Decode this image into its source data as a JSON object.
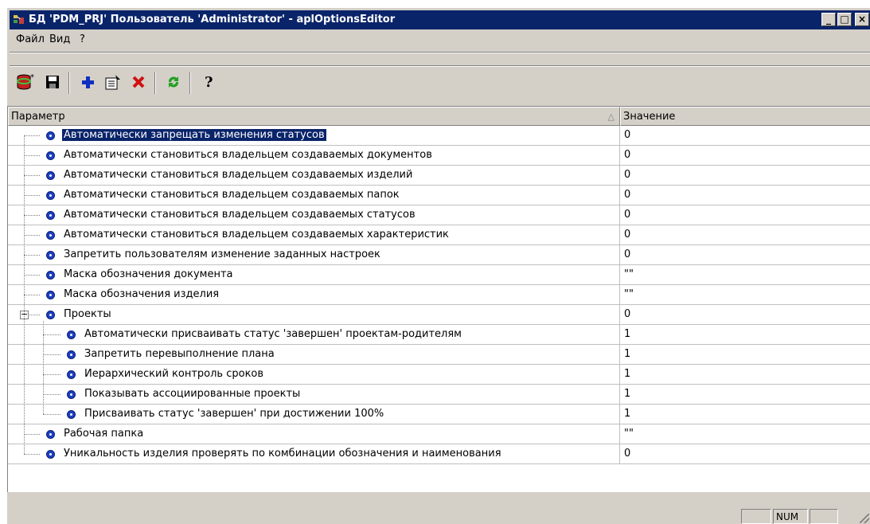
{
  "window": {
    "title": "БД 'PDM_PRJ' Пользователь 'Administrator' - aplOptionsEditor",
    "min_label": "_",
    "max_label": "□",
    "close_label": "×"
  },
  "menu": {
    "file": "Файл",
    "view": "Вид",
    "help": "?"
  },
  "toolbar": {
    "buttons": [
      "connect-db",
      "save",
      "add",
      "properties",
      "delete",
      "refresh",
      "help"
    ]
  },
  "grid": {
    "columns": {
      "param": "Параметр",
      "value": "Значение"
    },
    "rows": [
      {
        "label": "Автоматически запрещать изменения статусов",
        "value": "0",
        "level": 0,
        "selected": true
      },
      {
        "label": "Автоматически становиться владельцем создаваемых документов",
        "value": "0",
        "level": 0
      },
      {
        "label": "Автоматически становиться владельцем создаваемых изделий",
        "value": "0",
        "level": 0
      },
      {
        "label": "Автоматически становиться владельцем создаваемых папок",
        "value": "0",
        "level": 0
      },
      {
        "label": "Автоматически становиться владельцем создаваемых статусов",
        "value": "0",
        "level": 0
      },
      {
        "label": "Автоматически становиться владельцем создаваемых характеристик",
        "value": "0",
        "level": 0
      },
      {
        "label": "Запретить пользователям изменение заданных настроек",
        "value": "0",
        "level": 0
      },
      {
        "label": "Маска обозначения документа",
        "value": "\"\"",
        "level": 0
      },
      {
        "label": "Маска обозначения изделия",
        "value": "\"\"",
        "level": 0
      },
      {
        "label": "Проекты",
        "value": "0",
        "level": 0,
        "expanded": true
      },
      {
        "label": "Автоматически присваивать статус 'завершен' проектам-родителям",
        "value": "1",
        "level": 1
      },
      {
        "label": "Запретить перевыполнение плана",
        "value": "1",
        "level": 1
      },
      {
        "label": "Иерархический контроль сроков",
        "value": "1",
        "level": 1
      },
      {
        "label": "Показывать ассоциированные проекты",
        "value": "1",
        "level": 1
      },
      {
        "label": "Присваивать статус 'завершен' при достижении 100%",
        "value": "1",
        "level": 1
      },
      {
        "label": "Рабочая папка",
        "value": "\"\"",
        "level": 0
      },
      {
        "label": "Уникальность изделия проверять по комбинации обозначения и наименования",
        "value": "0",
        "level": 0
      }
    ]
  },
  "status": {
    "num": "NUM"
  },
  "colors": {
    "selection": "#0a246a",
    "node_icon": "#1c3fbf",
    "face": "#d4d0c8"
  }
}
